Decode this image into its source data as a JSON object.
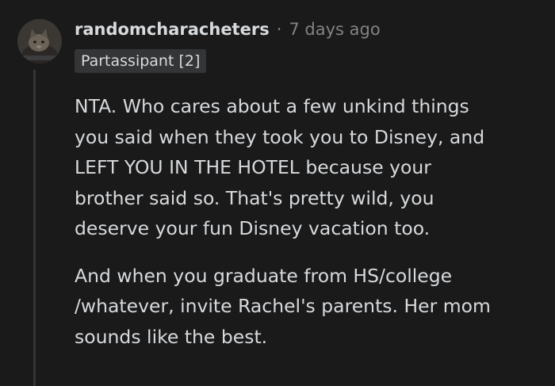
{
  "comment": {
    "avatar_icon": "user-avatar-cat",
    "username": "randomcharacheters",
    "separator": "·",
    "timestamp": "7 days ago",
    "flair": "Partassipant [2]",
    "paragraphs": [
      {
        "lines": [
          "NTA. Who cares about a few unkind things",
          "you said when they took you to Disney, and",
          "LEFT YOU IN THE HOTEL because your",
          "brother said so. That's pretty wild, you",
          "deserve your fun Disney vacation too."
        ]
      },
      {
        "lines": [
          "And when you graduate from HS/college",
          "/whatever, invite Rachel's parents. Her mom",
          "sounds like the best."
        ]
      }
    ]
  },
  "colors": {
    "background": "#1a1a1b",
    "text": "#d7dadc",
    "meta": "#818384",
    "flair_bg": "#343536",
    "thread_line": "#343536"
  }
}
